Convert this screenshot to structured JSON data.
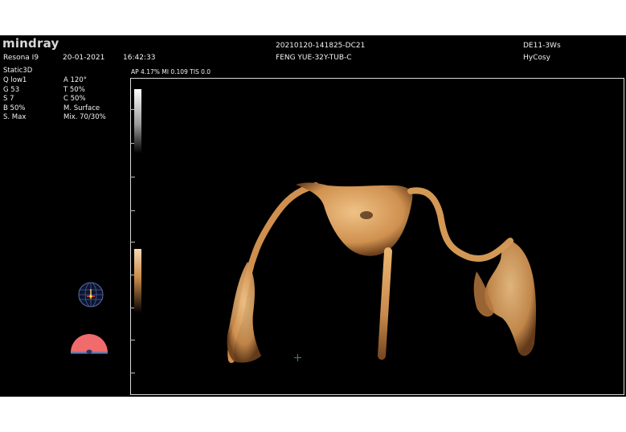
{
  "header": {
    "logo": "mindray",
    "study_id": "20210120-141825-DC21",
    "probe_code": "DE11-3Ws",
    "system": "Resona I9",
    "date": "20-01-2021",
    "time": "16:42:33",
    "patient": "FENG YUE-32Y-TUB-C",
    "exam": "HyCosy"
  },
  "info_bar": "AP 4.17%  MI 0.109 TIS 0.0",
  "params": {
    "mode": "Static3D",
    "left": [
      "Q low1",
      "G 53",
      "S 7",
      "B 50%",
      "S. Max"
    ],
    "right": [
      "A 120°",
      "T 50%",
      "C 50%",
      "M. Surface",
      "Mix. 70/30%"
    ]
  },
  "icons": {
    "orientation": "orientation-globe-icon",
    "probe_sector": "probe-sector-icon"
  },
  "colors": {
    "background": "#000000",
    "render": "#d99a55",
    "sector": "#f06b6b"
  }
}
